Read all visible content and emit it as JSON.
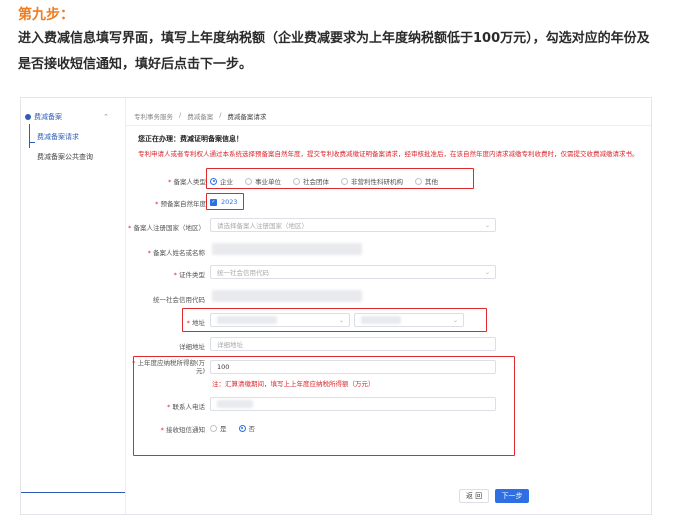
{
  "article": {
    "step_title": "第九步：",
    "intro": "进入费减信息填写界面，填写上年度纳税额（企业费减要求为上年度纳税额低于100万元），勾选对应的年份及是否接收短信通知，填好后点击下一步。"
  },
  "sidebar": {
    "group_label": "费减备案",
    "items": [
      {
        "label": "费减备案请求"
      },
      {
        "label": "费减备案公共查询"
      }
    ]
  },
  "breadcrumb": [
    "专利事务服务",
    "费减备案",
    "费减备案请求"
  ],
  "form": {
    "doing_title": "您正在办理：费减证明备案信息！",
    "notice": "专利申请人或者专利权人通过本系统选择预备案自然年度，提交专利收费减缴证明备案请求，经审核批准后，在该自然年度内请求减缴专利收费时，仅需提交收费减缴请求书。",
    "applicant_type": {
      "label": "备案人类型",
      "options": [
        "企业",
        "事业单位",
        "社会团体",
        "非营利性科研机构",
        "其他"
      ],
      "selected": "企业"
    },
    "year": {
      "label": "预备案自然年度",
      "value": "2023",
      "checked": true
    },
    "country": {
      "label": "备案人注册国家（地区）",
      "placeholder": "请选择备案人注册国家（地区）"
    },
    "name": {
      "label": "备案人姓名或名称"
    },
    "id_type": {
      "label": "证件类型",
      "value": "统一社会信用代码"
    },
    "credit_code": {
      "label": "统一社会信用代码"
    },
    "address": {
      "label": "地址"
    },
    "detail_address": {
      "label": "详细地址",
      "placeholder": "详细地址"
    },
    "tax": {
      "label": "上年度应纳税所得额(万元)",
      "value": "100",
      "hint": "注：汇算清缴期间，填写上上年度应纳税所得额（万元）"
    },
    "phone": {
      "label": "联系人电话"
    },
    "sms": {
      "label": "接收短信通知",
      "options": [
        "是",
        "否"
      ],
      "selected": "否"
    }
  },
  "buttons": {
    "back": "返 回",
    "next": "下一步"
  }
}
